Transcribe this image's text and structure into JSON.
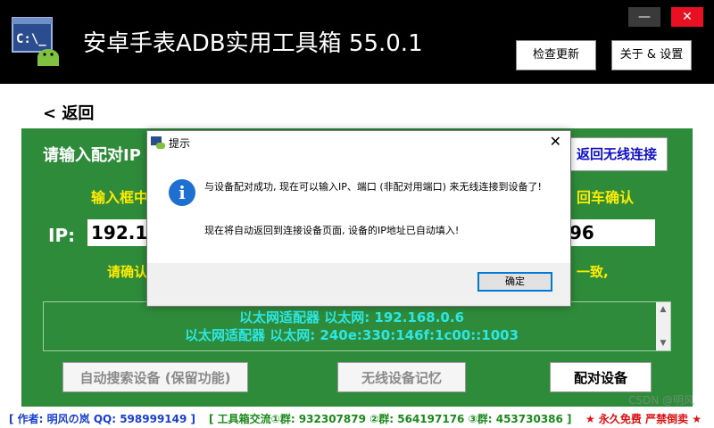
{
  "window": {
    "title": "安卓手表ADB实用工具箱  55.0.1",
    "minimize_glyph": "—",
    "close_glyph": "✕",
    "check_update_label": "检查更新",
    "about_settings_label": "关于 & 设置",
    "icon": "terminal-android-icon"
  },
  "main": {
    "back_label": "< 返回",
    "prompt_label": "请输入配对IP",
    "wireless_button_label": "返回无线连接",
    "input_hint_left": "输入框中",
    "input_hint_right": "回车确认",
    "ip_label": "IP:",
    "ip_value": "192.16",
    "port_value": "96",
    "confirm_hint_left": "请确认",
    "confirm_hint_right": "一致,",
    "adapters": [
      "以太网适配器 以太网: 192.168.0.6",
      "以太网适配器 以太网: 240e:330:146f:1c00::1003"
    ],
    "search_button_label": "自动搜索设备 (保留功能)",
    "memory_button_label": "无线设备记忆",
    "pair_button_label": "配对设备"
  },
  "footer": {
    "author": "[ 作者: 明风の岚  QQ: 598999149 ]",
    "groups": "[ 工具箱交流①群: 932307879  ②群: 564197176  ③群: 453730386 ]",
    "free": "★ 永久免费 严禁倒卖 ★"
  },
  "dialog": {
    "title": "提示",
    "close_glyph": "✕",
    "info_glyph": "i",
    "message_1": "与设备配对成功, 现在可以输入IP、端口 (非配对用端口) 来无线连接到设备了!",
    "message_2": "现在将自动返回到连接设备页面, 设备的IP地址已自动填入!",
    "ok_label": "确定"
  },
  "watermark": "CSDN @明风",
  "colors": {
    "panel_green": "#2e8b3a",
    "hint_yellow": "#ffeb00",
    "adapter_cyan": "#2ee6e6",
    "info_blue": "#1e6fd0"
  }
}
